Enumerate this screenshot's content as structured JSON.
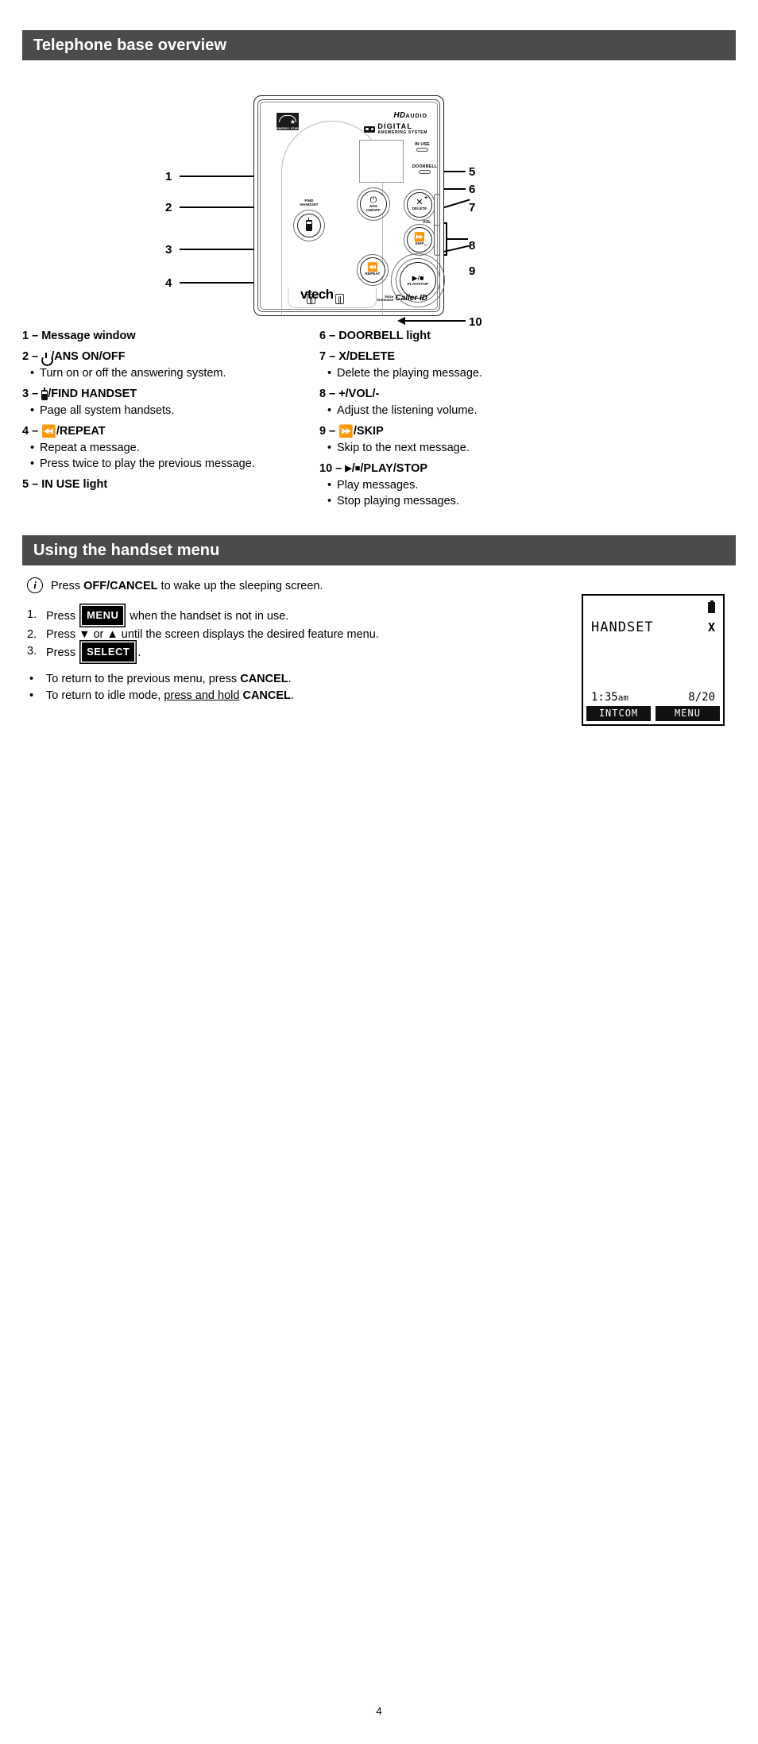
{
  "sections": {
    "overview_title": "Telephone base overview",
    "handset_title": "Using the handset menu"
  },
  "diagram": {
    "callouts": [
      "1",
      "2",
      "3",
      "4",
      "5",
      "6",
      "7",
      "8",
      "9",
      "10"
    ],
    "base_marks": {
      "energy_star": "ENERGY STAR",
      "hd": "HD",
      "audio": "AUDIO",
      "digital": "DIGITAL",
      "answering_system": "ANSWERING SYSTEM",
      "in_use_led": "IN USE",
      "doorbell_led": "DOORBELL",
      "find_handset_cap": "FIND\nHANDSET",
      "ans_onoff_cap": "ANS\nON/OFF",
      "delete_cap": "DELETE",
      "skip_cap": "SKIP",
      "repeat_cap": "REPEAT",
      "play_stop_cap": "PLAY/STOP",
      "vol_plus": "+",
      "vol_label": "VOL",
      "vol_minus": "–",
      "brand": "vtech",
      "voice_announce": "Voice\nAnnounce",
      "caller_id": "Caller ID"
    }
  },
  "legend": {
    "left": [
      {
        "num": "1 – ",
        "icon": "",
        "label": "Message window",
        "bullets": []
      },
      {
        "num": "2 – ",
        "icon": "power-icon",
        "label": "/ANS ON/OFF",
        "bullets": [
          "Turn on or off the answering system."
        ]
      },
      {
        "num": "3 – ",
        "icon": "handset-icon",
        "label": "/FIND HANDSET",
        "bullets": [
          "Page all system handsets."
        ]
      },
      {
        "num": "4 – ",
        "icon": "rewind-icon",
        "label": "/REPEAT",
        "bullets": [
          "Repeat a message.",
          "Press twice to play the previous message."
        ]
      },
      {
        "num": "5 – ",
        "icon": "",
        "label": "IN USE light",
        "bullets": []
      }
    ],
    "right": [
      {
        "num": "6 – ",
        "icon": "",
        "label": "DOORBELL light",
        "bullets": []
      },
      {
        "num": "7 – ",
        "icon": "",
        "label": "X/DELETE",
        "bullets": [
          "Delete the playing message."
        ]
      },
      {
        "num": "8 – ",
        "icon": "",
        "label": "+/VOL/-",
        "bullets": [
          "Adjust the listening volume."
        ]
      },
      {
        "num": "9 – ",
        "icon": "fastforward-icon",
        "label": "/SKIP",
        "bullets": [
          "Skip to the next message."
        ]
      },
      {
        "num": "10 – ",
        "icon": "play-stop-icon",
        "label": "/PLAY/STOP",
        "bullets": [
          "Play messages.",
          "Stop playing messages."
        ]
      }
    ]
  },
  "handset": {
    "info_icon": "i",
    "info_text_pre": "Press ",
    "info_key": "OFF/CANCEL",
    "info_text_post": " to wake up the sleeping screen.",
    "steps": [
      {
        "num": "1.",
        "pre": "Press ",
        "keycap": "MENU",
        "post": " when the handset is not in use."
      },
      {
        "num": "2.",
        "pre": "Press ▼ or ▲ until the screen displays the desired feature menu.",
        "keycap": "",
        "post": ""
      },
      {
        "num": "3.",
        "pre": "Press ",
        "keycap": "SELECT",
        "post": "."
      }
    ],
    "tips": [
      {
        "bullet": "•",
        "pre": "To return to the previous menu, press ",
        "strong": "CANCEL",
        "post": "."
      },
      {
        "bullet": "•",
        "pre": "To return to idle mode, ",
        "underline": "press and hold",
        "strong": "CANCEL",
        "post": "."
      }
    ],
    "lcd": {
      "battery_icon": "battery-full-icon",
      "title": "HANDSET",
      "corner_icon": "X",
      "time": "1:35",
      "time_suffix": "am",
      "date": "8/20",
      "softkey_left": "INTCOM",
      "softkey_right": "MENU"
    }
  },
  "footer": {
    "page_number": "4"
  }
}
